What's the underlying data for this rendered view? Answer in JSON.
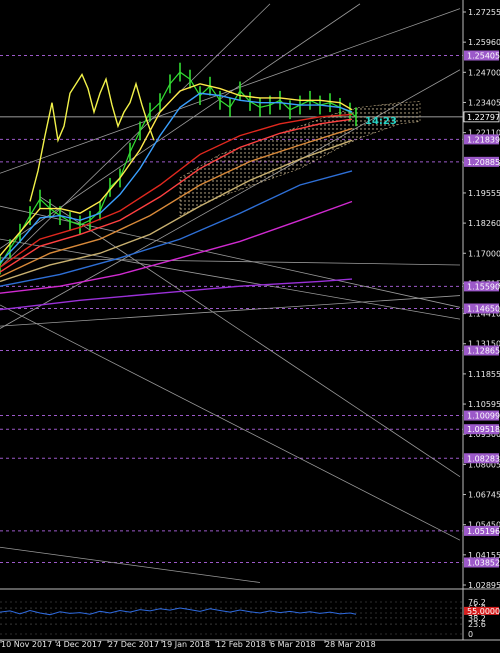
{
  "chart_data": [
    {
      "type": "line",
      "title": "",
      "ylim": [
        1.02895,
        1.2754
      ],
      "price_ticks": [
        "1.27255",
        "1.25960",
        "1.24700",
        "1.23405",
        "1.22110",
        "1.20825",
        "1.19555",
        "1.18260",
        "1.17000",
        "1.15715",
        "1.14410",
        "1.13150",
        "1.11855",
        "1.10595",
        "1.09300",
        "1.08005",
        "1.06745",
        "1.05450",
        "1.04155",
        "1.02895"
      ],
      "current_price": {
        "label": "1.22797",
        "value": 1.22797,
        "color": "#ffffff"
      },
      "level_badges": [
        {
          "label": "1.25405",
          "value": 1.25405,
          "color": "#9c59c9"
        },
        {
          "label": "1.21839",
          "value": 1.21839,
          "color": "#9c59c9"
        },
        {
          "label": "1.20885",
          "value": 1.20885,
          "color": "#9c59c9"
        },
        {
          "label": "1.15590",
          "value": 1.1559,
          "color": "#9c59c9"
        },
        {
          "label": "1.14650",
          "value": 1.1465,
          "color": "#9c59c9"
        },
        {
          "label": "1.12865",
          "value": 1.12865,
          "color": "#9c59c9"
        },
        {
          "label": "1.10099",
          "value": 1.10099,
          "color": "#9c59c9"
        },
        {
          "label": "1.09518",
          "value": 1.09518,
          "color": "#9c59c9"
        },
        {
          "label": "1.08283",
          "value": 1.08283,
          "color": "#9c59c9"
        },
        {
          "label": "1.05196",
          "value": 1.05196,
          "color": "#9c59c9"
        },
        {
          "label": "1.03852",
          "value": 1.03852,
          "color": "#9c59c9"
        }
      ],
      "timer_label": "14:23",
      "series": [
        {
          "key": "close",
          "color": "#33dd33",
          "x": [
            0,
            10,
            20,
            30,
            40,
            50,
            60,
            70,
            80,
            90,
            100,
            110,
            120,
            130,
            140,
            150,
            160,
            170,
            180,
            190,
            200,
            210,
            220,
            230,
            240,
            250,
            260,
            270,
            280,
            290,
            300,
            310,
            320,
            330,
            340,
            350,
            356
          ],
          "y": [
            1.165,
            1.172,
            1.1785,
            1.186,
            1.193,
            1.189,
            1.186,
            1.1835,
            1.182,
            1.184,
            1.188,
            1.198,
            1.202,
            1.213,
            1.222,
            1.23,
            1.234,
            1.242,
            1.247,
            1.244,
            1.237,
            1.241,
            1.235,
            1.232,
            1.239,
            1.2345,
            1.232,
            1.233,
            1.235,
            1.231,
            1.233,
            1.235,
            1.233,
            1.234,
            1.232,
            1.23,
            1.228
          ]
        },
        {
          "key": "yellow-line",
          "color": "#f2f24a",
          "x": [
            30,
            38,
            45,
            52,
            58,
            64,
            70,
            76,
            82,
            88,
            94,
            100,
            106,
            112,
            118,
            124,
            130,
            136,
            142,
            148,
            154
          ],
          "y": [
            1.192,
            1.205,
            1.22,
            1.234,
            1.218,
            1.224,
            1.238,
            1.242,
            1.246,
            1.24,
            1.23,
            1.238,
            1.244,
            1.233,
            1.224,
            1.23,
            1.234,
            1.242,
            1.233,
            1.225,
            1.218
          ]
        },
        {
          "key": "yellow-ma",
          "color": "#ffe94a",
          "x": [
            0,
            20,
            40,
            60,
            80,
            100,
            120,
            140,
            160,
            180,
            200,
            220,
            240,
            260,
            280,
            300,
            320,
            340,
            352
          ],
          "y": [
            1.169,
            1.179,
            1.189,
            1.189,
            1.187,
            1.192,
            1.202,
            1.214,
            1.23,
            1.239,
            1.242,
            1.24,
            1.237,
            1.236,
            1.236,
            1.235,
            1.235,
            1.234,
            1.231
          ]
        },
        {
          "key": "blue-ma",
          "color": "#3aa0ff",
          "x": [
            0,
            20,
            40,
            60,
            80,
            100,
            120,
            140,
            160,
            180,
            200,
            220,
            240,
            260,
            280,
            300,
            320,
            340,
            352
          ],
          "y": [
            1.166,
            1.175,
            1.185,
            1.186,
            1.184,
            1.187,
            1.195,
            1.206,
            1.22,
            1.232,
            1.238,
            1.237,
            1.235,
            1.234,
            1.234,
            1.233,
            1.233,
            1.232,
            1.23
          ]
        },
        {
          "key": "red-ma",
          "color": "#e0281e",
          "x": [
            0,
            40,
            80,
            120,
            160,
            200,
            240,
            280,
            320,
            352
          ],
          "y": [
            1.164,
            1.176,
            1.181,
            1.188,
            1.199,
            1.212,
            1.22,
            1.225,
            1.228,
            1.229
          ]
        },
        {
          "key": "red-ma-2",
          "color": "#ff4040",
          "x": [
            0,
            40,
            80,
            120,
            160,
            200,
            240,
            280,
            320,
            352
          ],
          "y": [
            1.162,
            1.173,
            1.178,
            1.184,
            1.194,
            1.206,
            1.215,
            1.221,
            1.225,
            1.227
          ]
        },
        {
          "key": "orange-ma",
          "color": "#d98a3a",
          "x": [
            0,
            50,
            100,
            150,
            200,
            250,
            300,
            352
          ],
          "y": [
            1.16,
            1.17,
            1.176,
            1.186,
            1.199,
            1.209,
            1.216,
            1.223
          ]
        },
        {
          "key": "tan-ma",
          "color": "#c8b070",
          "x": [
            0,
            50,
            100,
            150,
            200,
            250,
            300,
            352
          ],
          "y": [
            1.158,
            1.165,
            1.17,
            1.178,
            1.19,
            1.201,
            1.21,
            1.218
          ]
        },
        {
          "key": "steelblue-ma",
          "color": "#2e6fd6",
          "x": [
            0,
            60,
            120,
            180,
            240,
            300,
            352
          ],
          "y": [
            1.156,
            1.161,
            1.168,
            1.176,
            1.187,
            1.199,
            1.205
          ]
        },
        {
          "key": "magenta-ma",
          "color": "#d02ad0",
          "x": [
            0,
            60,
            120,
            180,
            240,
            300,
            352
          ],
          "y": [
            1.153,
            1.156,
            1.161,
            1.168,
            1.175,
            1.184,
            1.192
          ]
        },
        {
          "key": "purple-ma",
          "color": "#9b30d9",
          "x": [
            0,
            80,
            160,
            240,
            320,
            352
          ],
          "y": [
            1.146,
            1.15,
            1.153,
            1.156,
            1.158,
            1.159
          ]
        }
      ],
      "trendlines": [
        {
          "key": "tl-1",
          "x": [
            0,
            460
          ],
          "y": [
            1.204,
            1.274
          ]
        },
        {
          "key": "tl-2",
          "x": [
            0,
            360
          ],
          "y": [
            1.172,
            1.276
          ]
        },
        {
          "key": "tl-3",
          "x": [
            0,
            270
          ],
          "y": [
            1.164,
            1.276
          ]
        },
        {
          "key": "tl-4",
          "x": [
            0,
            460
          ],
          "y": [
            1.138,
            1.248
          ]
        },
        {
          "key": "tl-5",
          "x": [
            0,
            460
          ],
          "y": [
            1.139,
            1.152
          ]
        },
        {
          "key": "tl-6",
          "x": [
            0,
            460
          ],
          "y": [
            1.19,
            1.147
          ]
        },
        {
          "key": "tl-7",
          "x": [
            0,
            460
          ],
          "y": [
            1.148,
            1.048
          ]
        },
        {
          "key": "tl-8",
          "x": [
            0,
            460
          ],
          "y": [
            1.168,
            1.165
          ]
        },
        {
          "key": "tl-9",
          "x": [
            0,
            260
          ],
          "y": [
            1.045,
            1.03
          ]
        },
        {
          "key": "tl-10",
          "x": [
            40,
            460
          ],
          "y": [
            1.194,
            1.075
          ]
        },
        {
          "key": "tl-11",
          "x": [
            0,
            460
          ],
          "y": [
            1.176,
            1.142
          ]
        }
      ],
      "cloud": {
        "x": [
          180,
          220,
          260,
          300,
          340,
          360,
          380,
          400,
          420
        ],
        "upper": [
          1.202,
          1.212,
          1.218,
          1.224,
          1.23,
          1.232,
          1.233,
          1.234,
          1.2345
        ],
        "lower": [
          1.186,
          1.194,
          1.2,
          1.206,
          1.215,
          1.219,
          1.222,
          1.225,
          1.226
        ]
      }
    },
    {
      "type": "line",
      "title": "",
      "ylim": [
        0,
        100
      ],
      "ticks": [
        "76.2",
        "61.8",
        "50",
        "38.2",
        "23.6",
        "0"
      ],
      "marker_value": 55,
      "marker_label": "55.0000",
      "series": [
        {
          "key": "rsi",
          "color": "#2f6be0",
          "x": [
            0,
            10,
            20,
            30,
            40,
            50,
            60,
            70,
            80,
            90,
            100,
            110,
            120,
            130,
            140,
            150,
            160,
            170,
            180,
            190,
            200,
            210,
            220,
            230,
            240,
            250,
            260,
            270,
            280,
            290,
            300,
            310,
            320,
            330,
            340,
            350,
            356
          ],
          "y": [
            52,
            55,
            48,
            56,
            50,
            46,
            53,
            49,
            51,
            47,
            54,
            50,
            56,
            52,
            58,
            55,
            60,
            57,
            62,
            58,
            54,
            60,
            56,
            52,
            57,
            53,
            50,
            55,
            51,
            54,
            50,
            53,
            49,
            52,
            48,
            50,
            47
          ]
        }
      ]
    }
  ],
  "x_axis": {
    "dates": [
      "10 Nov 2017",
      "4 Dec 2017",
      "27 Dec 2017",
      "19 Jan 2018",
      "12 Feb 2018",
      "6 Mar 2018",
      "28 Mar 2018"
    ],
    "date_positions": [
      0,
      55,
      107,
      161,
      215,
      269,
      324
    ]
  }
}
